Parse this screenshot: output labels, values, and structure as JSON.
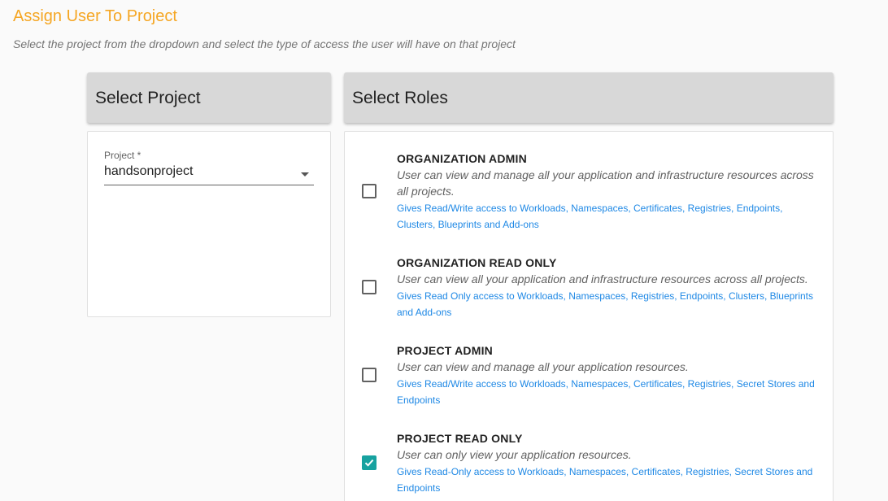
{
  "page": {
    "clipped_header": "",
    "title": "Assign User To Project",
    "subtitle": "Select the project from the dropdown and select the type of access the user will have on that project"
  },
  "project_panel": {
    "header": "Select Project",
    "field_label": "Project *",
    "field_value": "handsonproject"
  },
  "roles_panel": {
    "header": "Select Roles",
    "roles": [
      {
        "name": "ORGANIZATION ADMIN",
        "description": "User can view and manage all your application and infrastructure resources across all projects.",
        "access": "Gives Read/Write access to Workloads, Namespaces, Certificates, Registries, Endpoints, Clusters, Blueprints and Add-ons",
        "checked": false
      },
      {
        "name": "ORGANIZATION READ ONLY",
        "description": "User can view all your application and infrastructure resources across all projects.",
        "access": "Gives Read Only access to Workloads, Namespaces, Registries, Endpoints, Clusters, Blueprints and Add-ons",
        "checked": false
      },
      {
        "name": "PROJECT ADMIN",
        "description": "User can view and manage all your application resources.",
        "access": "Gives Read/Write access to Workloads, Namespaces, Certificates, Registries, Secret Stores and Endpoints",
        "checked": false
      },
      {
        "name": "PROJECT READ ONLY",
        "description": "User can only view your application resources.",
        "access": "Gives Read-Only access to Workloads, Namespaces, Certificates, Registries, Secret Stores and Endpoints",
        "checked": true
      }
    ]
  },
  "colors": {
    "title": "#f5a623",
    "checkbox_checked": "#17a2a0",
    "access_link": "#1e88e5"
  }
}
